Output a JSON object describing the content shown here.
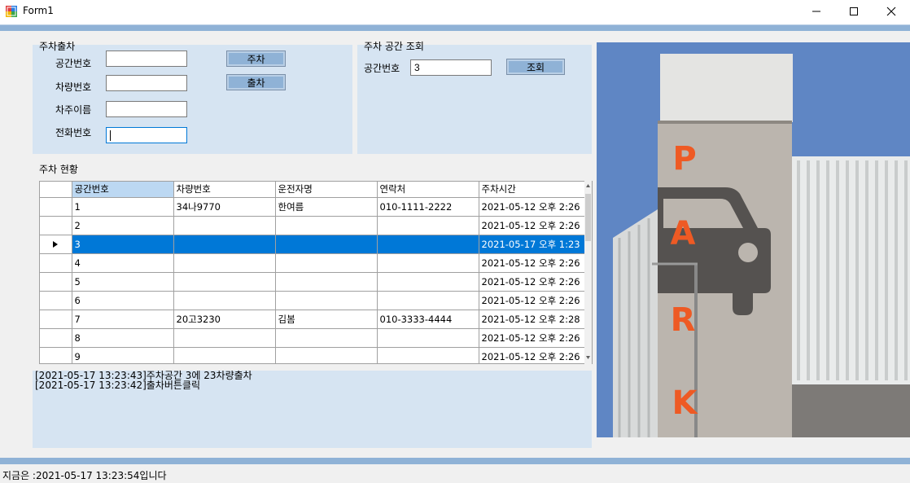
{
  "window": {
    "title": "Form1"
  },
  "parking_group": {
    "title": "주차출차",
    "labels": {
      "space": "공간번호",
      "car": "차량번호",
      "owner": "차주이름",
      "phone": "전화번호"
    },
    "values": {
      "space": "",
      "car": "",
      "owner": "",
      "phone": ""
    },
    "park_button": "주차",
    "exit_button": "출차"
  },
  "lookup_group": {
    "title": "주차 공간 조회",
    "label": "공간번호",
    "value": "3",
    "button": "조회"
  },
  "status_group": {
    "title": "주차 현황"
  },
  "table": {
    "columns": [
      "공간번호",
      "차량번호",
      "운전자명",
      "연락처",
      "주차시간"
    ],
    "rows": [
      [
        "1",
        "34나9770",
        "한여름",
        "010-1111-2222",
        "2021-05-12 오후 2:26"
      ],
      [
        "2",
        "",
        "",
        "",
        "2021-05-12 오후 2:26"
      ],
      [
        "3",
        "",
        "",
        "",
        "2021-05-17 오후 1:23"
      ],
      [
        "4",
        "",
        "",
        "",
        "2021-05-12 오후 2:26"
      ],
      [
        "5",
        "",
        "",
        "",
        "2021-05-12 오후 2:26"
      ],
      [
        "6",
        "",
        "",
        "",
        "2021-05-12 오후 2:26"
      ],
      [
        "7",
        "20고3230",
        "김봄",
        "010-3333-4444",
        "2021-05-12 오후 2:28"
      ],
      [
        "8",
        "",
        "",
        "",
        "2021-05-12 오후 2:26"
      ],
      [
        "9",
        "",
        "",
        "",
        "2021-05-12 오후 2:26"
      ]
    ],
    "selected_row": 3
  },
  "log": [
    "[2021-05-17 13:23:43]주차공간 3에 23차량출차",
    "[2021-05-17 13:23:42]출차버튼클릭"
  ],
  "statusbar": {
    "text": "지금은 :2021-05-17 13:23:54입니다"
  },
  "photo": {
    "letters": [
      "P",
      "A",
      "R",
      "K"
    ]
  },
  "colors": {
    "panel": "#d6e4f2",
    "accent_band": "#8fb2d6",
    "selection": "#0078d7",
    "park_letters": "#ee5a24"
  }
}
